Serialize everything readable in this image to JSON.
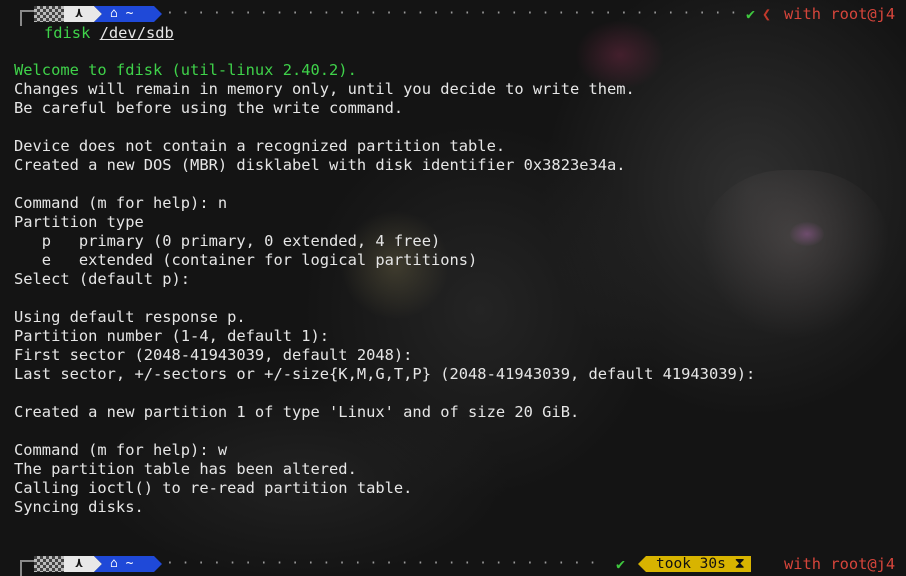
{
  "colors": {
    "background": "#141414",
    "text": "#e6e6e6",
    "green": "#3fd24a",
    "dir_segment": "#1f49d8",
    "user_host": "#d6453b",
    "took_segment": "#d8b400"
  },
  "top_prompt": {
    "os_icon": "arch-icon",
    "dir_icon": "home-icon",
    "dir_text": "~",
    "status_icon": "check-icon",
    "user_host": "with root@j4"
  },
  "command": {
    "program": "fdisk",
    "argument": "/dev/sdb"
  },
  "output": {
    "welcome": "Welcome to fdisk (util-linux 2.40.2).",
    "l1": "Changes will remain in memory only, until you decide to write them.",
    "l2": "Be careful before using the write command.",
    "l3": "Device does not contain a recognized partition table.",
    "l4": "Created a new DOS (MBR) disklabel with disk identifier 0x3823e34a.",
    "l5": "Command (m for help): n",
    "l6": "Partition type",
    "l7": "   p   primary (0 primary, 0 extended, 4 free)",
    "l8": "   e   extended (container for logical partitions)",
    "l9": "Select (default p):",
    "l10": "Using default response p.",
    "l11": "Partition number (1-4, default 1):",
    "l12": "First sector (2048-41943039, default 2048):",
    "l13": "Last sector, +/-sectors or +/-size{K,M,G,T,P} (2048-41943039, default 41943039):",
    "l14": "Created a new partition 1 of type 'Linux' and of size 20 GiB.",
    "l15": "Command (m for help): w",
    "l16": "The partition table has been altered.",
    "l17": "Calling ioctl() to re-read partition table.",
    "l18": "Syncing disks."
  },
  "bottom_prompt": {
    "os_icon": "arch-icon",
    "dir_icon": "home-icon",
    "dir_text": "~",
    "status_icon": "check-icon",
    "took": "took 30s",
    "took_icon": "hourglass-icon",
    "user_host": "with root@j4"
  }
}
